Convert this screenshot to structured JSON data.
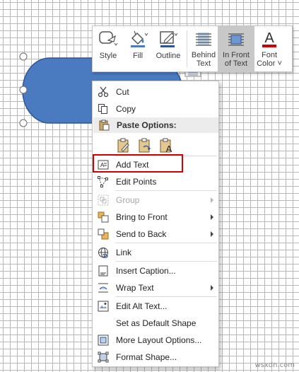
{
  "mini_toolbar": {
    "style": "Style",
    "fill": "Fill",
    "outline": "Outline",
    "behind_text_1": "Behind",
    "behind_text_2": "Text",
    "in_front_1": "In Front",
    "in_front_2": "of Text",
    "font_color_1": "Font",
    "font_color_2": "Color ˅"
  },
  "colors": {
    "shape_fill": "#4a7bc0",
    "shape_stroke": "#2f5597",
    "highlight": "#d10000",
    "active_tool": "#c8c8c8",
    "accent_red": "#d10000"
  },
  "context_menu": {
    "cut": "Cut",
    "copy": "Copy",
    "paste_options": "Paste Options:",
    "add_text": "Add Text",
    "edit_points": "Edit Points",
    "group": "Group",
    "bring_to_front": "Bring to Front",
    "send_to_back": "Send to Back",
    "link": "Link",
    "insert_caption": "Insert Caption...",
    "wrap_text": "Wrap Text",
    "edit_alt_text": "Edit Alt Text...",
    "set_default_shape": "Set as Default Shape",
    "more_layout_options": "More Layout Options...",
    "format_shape": "Format Shape..."
  },
  "watermark": "wsxdn.com"
}
